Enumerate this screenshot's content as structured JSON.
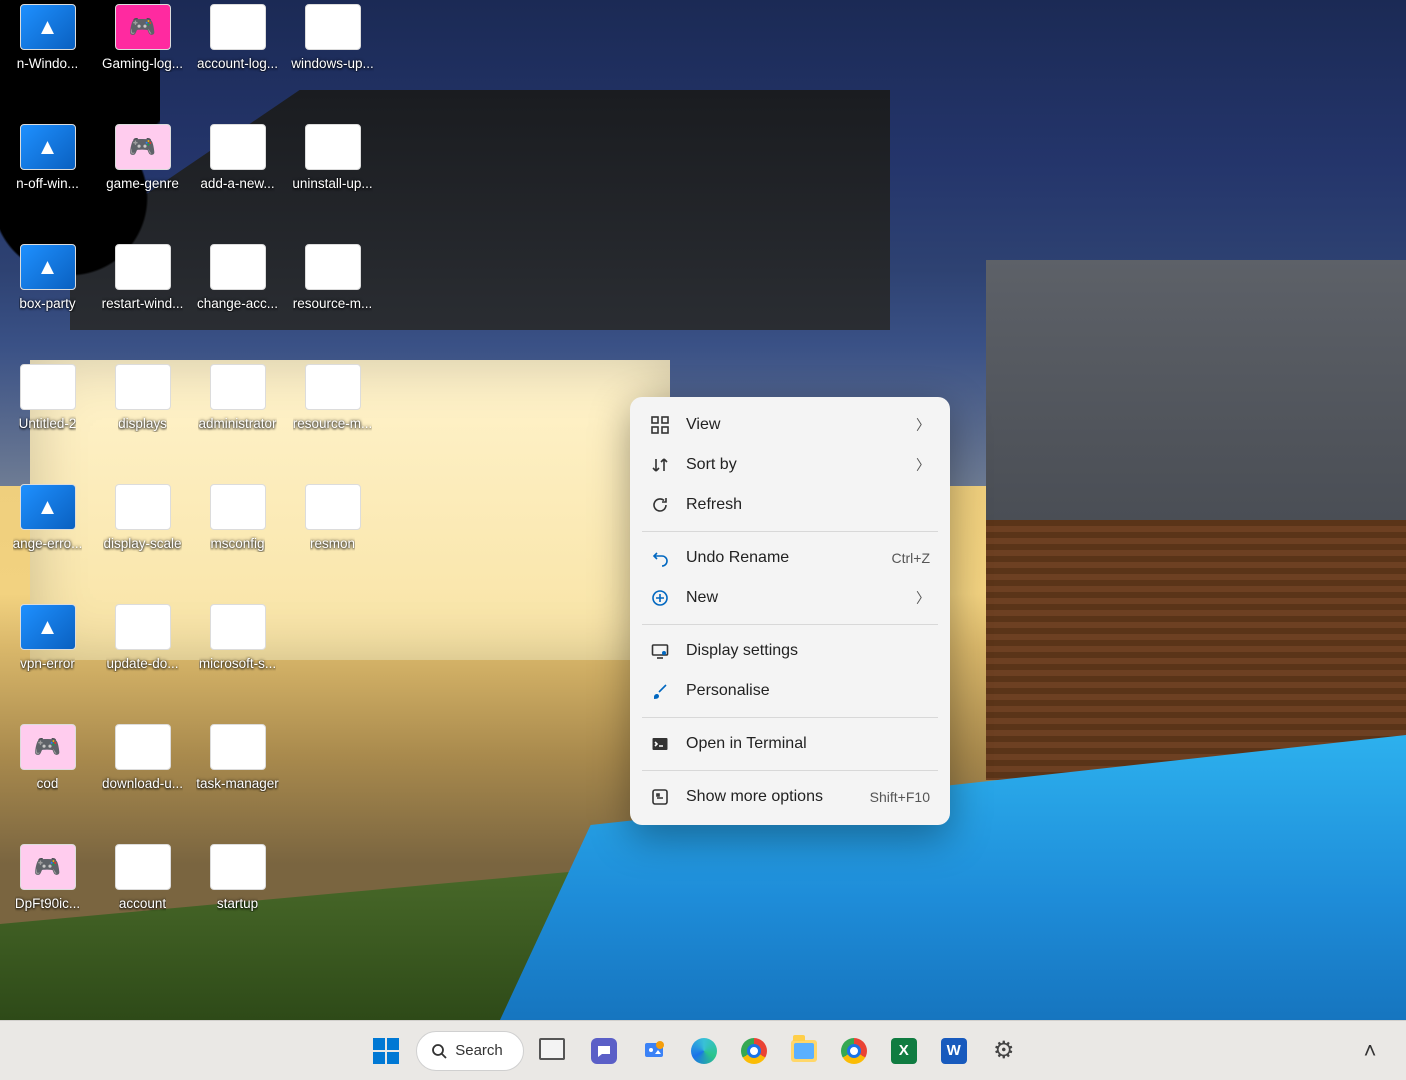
{
  "desktop": {
    "icons": [
      {
        "label": "n-Windo..."
      },
      {
        "label": "Gaming-log..."
      },
      {
        "label": "account-log..."
      },
      {
        "label": "windows-up..."
      },
      {
        "label": "n-off-win..."
      },
      {
        "label": "game-genre"
      },
      {
        "label": "add-a-new..."
      },
      {
        "label": "uninstall-up..."
      },
      {
        "label": "box-party"
      },
      {
        "label": "restart-wind..."
      },
      {
        "label": "change-acc..."
      },
      {
        "label": "resource-m..."
      },
      {
        "label": "Untitled-2"
      },
      {
        "label": "displays"
      },
      {
        "label": "administrator"
      },
      {
        "label": "resource-m..."
      },
      {
        "label": "ange-erro..."
      },
      {
        "label": "display-scale"
      },
      {
        "label": "msconfig"
      },
      {
        "label": "resmon"
      },
      {
        "label": "vpn-error"
      },
      {
        "label": "update-do..."
      },
      {
        "label": "microsoft-s..."
      },
      {
        "label": ""
      },
      {
        "label": "cod"
      },
      {
        "label": "download-u..."
      },
      {
        "label": "task-manager"
      },
      {
        "label": ""
      },
      {
        "label": "DpFt90ic..."
      },
      {
        "label": "account"
      },
      {
        "label": "startup"
      },
      {
        "label": ""
      }
    ]
  },
  "context_menu": {
    "view": "View",
    "sort_by": "Sort by",
    "refresh": "Refresh",
    "undo_rename": "Undo Rename",
    "undo_shortcut": "Ctrl+Z",
    "new": "New",
    "display_settings": "Display settings",
    "personalise": "Personalise",
    "open_terminal": "Open in Terminal",
    "show_more": "Show more options",
    "show_more_shortcut": "Shift+F10"
  },
  "taskbar": {
    "search_placeholder": "Search"
  }
}
